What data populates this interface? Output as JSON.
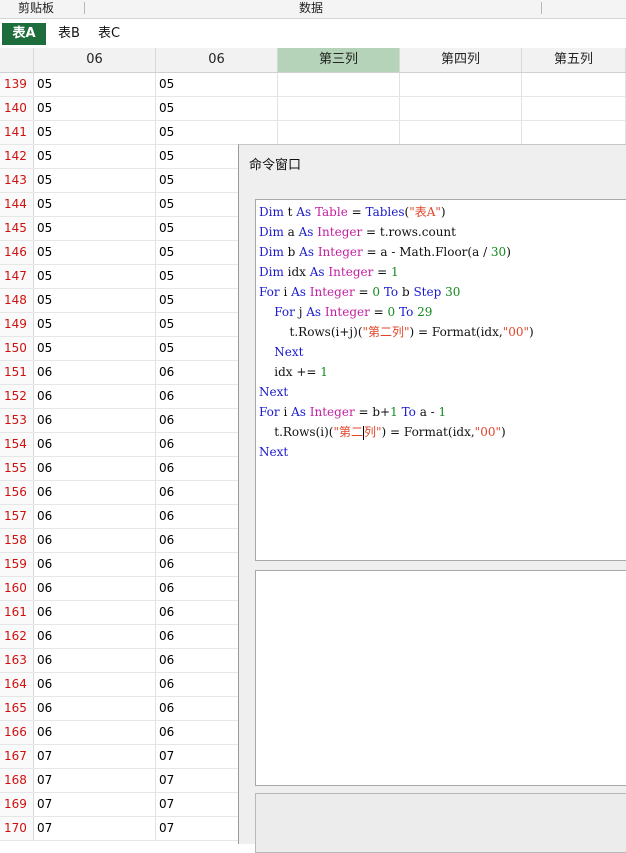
{
  "ribbon": {
    "groups": [
      "剪贴板",
      "数据"
    ]
  },
  "tabs": [
    {
      "label": "表A",
      "active": true
    },
    {
      "label": "表B",
      "active": false
    },
    {
      "label": "表C",
      "active": false
    }
  ],
  "grid": {
    "columns": [
      "06",
      "06",
      "第三列",
      "第四列",
      "第五列"
    ],
    "selected_column": "第三列",
    "rows": [
      {
        "n": "139",
        "a": "05",
        "b": "05"
      },
      {
        "n": "140",
        "a": "05",
        "b": "05"
      },
      {
        "n": "141",
        "a": "05",
        "b": "05"
      },
      {
        "n": "142",
        "a": "05",
        "b": "05"
      },
      {
        "n": "143",
        "a": "05",
        "b": "05"
      },
      {
        "n": "144",
        "a": "05",
        "b": "05"
      },
      {
        "n": "145",
        "a": "05",
        "b": "05"
      },
      {
        "n": "146",
        "a": "05",
        "b": "05"
      },
      {
        "n": "147",
        "a": "05",
        "b": "05"
      },
      {
        "n": "148",
        "a": "05",
        "b": "05"
      },
      {
        "n": "149",
        "a": "05",
        "b": "05"
      },
      {
        "n": "150",
        "a": "05",
        "b": "05"
      },
      {
        "n": "151",
        "a": "06",
        "b": "06"
      },
      {
        "n": "152",
        "a": "06",
        "b": "06"
      },
      {
        "n": "153",
        "a": "06",
        "b": "06"
      },
      {
        "n": "154",
        "a": "06",
        "b": "06"
      },
      {
        "n": "155",
        "a": "06",
        "b": "06"
      },
      {
        "n": "156",
        "a": "06",
        "b": "06"
      },
      {
        "n": "157",
        "a": "06",
        "b": "06"
      },
      {
        "n": "158",
        "a": "06",
        "b": "06"
      },
      {
        "n": "159",
        "a": "06",
        "b": "06"
      },
      {
        "n": "160",
        "a": "06",
        "b": "06"
      },
      {
        "n": "161",
        "a": "06",
        "b": "06"
      },
      {
        "n": "162",
        "a": "06",
        "b": "06"
      },
      {
        "n": "163",
        "a": "06",
        "b": "06"
      },
      {
        "n": "164",
        "a": "06",
        "b": "06"
      },
      {
        "n": "165",
        "a": "06",
        "b": "06"
      },
      {
        "n": "166",
        "a": "06",
        "b": "06"
      },
      {
        "n": "167",
        "a": "07",
        "b": "07"
      },
      {
        "n": "168",
        "a": "07",
        "b": "07"
      },
      {
        "n": "169",
        "a": "07",
        "b": "07"
      },
      {
        "n": "170",
        "a": "07",
        "b": "07"
      }
    ]
  },
  "command_window": {
    "title": "命令窗口",
    "code_lines": [
      [
        [
          "k",
          "Dim"
        ],
        [
          "p",
          " t "
        ],
        [
          "k",
          "As"
        ],
        [
          "p",
          " "
        ],
        [
          "t",
          "Table"
        ],
        [
          "p",
          " = "
        ],
        [
          "k",
          "Tables"
        ],
        [
          "p",
          "("
        ],
        [
          "s",
          "\"表A\""
        ],
        [
          "p",
          ")"
        ]
      ],
      [
        [
          "k",
          "Dim"
        ],
        [
          "p",
          " a "
        ],
        [
          "k",
          "As"
        ],
        [
          "p",
          " "
        ],
        [
          "t",
          "Integer"
        ],
        [
          "p",
          " = t.rows.count"
        ]
      ],
      [
        [
          "k",
          "Dim"
        ],
        [
          "p",
          " b "
        ],
        [
          "k",
          "As"
        ],
        [
          "p",
          " "
        ],
        [
          "t",
          "Integer"
        ],
        [
          "p",
          " = a - Math.Floor(a / "
        ],
        [
          "n",
          "30"
        ],
        [
          "p",
          ")"
        ]
      ],
      [
        [
          "k",
          "Dim"
        ],
        [
          "p",
          " idx "
        ],
        [
          "k",
          "As"
        ],
        [
          "p",
          " "
        ],
        [
          "t",
          "Integer"
        ],
        [
          "p",
          " = "
        ],
        [
          "n",
          "1"
        ]
      ],
      [
        [
          "k",
          "For"
        ],
        [
          "p",
          " i "
        ],
        [
          "k",
          "As"
        ],
        [
          "p",
          " "
        ],
        [
          "t",
          "Integer"
        ],
        [
          "p",
          " = "
        ],
        [
          "n",
          "0"
        ],
        [
          "p",
          " "
        ],
        [
          "k",
          "To"
        ],
        [
          "p",
          " b "
        ],
        [
          "k",
          "Step"
        ],
        [
          "p",
          " "
        ],
        [
          "n",
          "30"
        ]
      ],
      [
        [
          "p",
          "    "
        ],
        [
          "k",
          "For"
        ],
        [
          "p",
          " j "
        ],
        [
          "k",
          "As"
        ],
        [
          "p",
          " "
        ],
        [
          "t",
          "Integer"
        ],
        [
          "p",
          " = "
        ],
        [
          "n",
          "0"
        ],
        [
          "p",
          " "
        ],
        [
          "k",
          "To"
        ],
        [
          "p",
          " "
        ],
        [
          "n",
          "29"
        ]
      ],
      [
        [
          "p",
          "        t.Rows(i+j)("
        ],
        [
          "s",
          "\"第二列\""
        ],
        [
          "p",
          ") = Format(idx,"
        ],
        [
          "s",
          "\"00\""
        ],
        [
          "p",
          ")"
        ]
      ],
      [
        [
          "p",
          "    "
        ],
        [
          "k",
          "Next"
        ]
      ],
      [
        [
          "p",
          "    idx += "
        ],
        [
          "n",
          "1"
        ]
      ],
      [
        [
          "k",
          "Next"
        ]
      ],
      [
        [
          "k",
          "For"
        ],
        [
          "p",
          " i "
        ],
        [
          "k",
          "As"
        ],
        [
          "p",
          " "
        ],
        [
          "t",
          "Integer"
        ],
        [
          "p",
          " = b+"
        ],
        [
          "n",
          "1"
        ],
        [
          "p",
          " "
        ],
        [
          "k",
          "To"
        ],
        [
          "p",
          " a - "
        ],
        [
          "n",
          "1"
        ]
      ],
      [
        [
          "p",
          "    t.Rows(i)("
        ],
        [
          "s",
          "\"第二"
        ],
        [
          "caret",
          ""
        ],
        [
          "s",
          "列\""
        ],
        [
          "p",
          ") = Format(idx,"
        ],
        [
          "s",
          "\"00\""
        ],
        [
          "p",
          ")"
        ]
      ],
      [
        [
          "k",
          "Next"
        ]
      ]
    ]
  }
}
